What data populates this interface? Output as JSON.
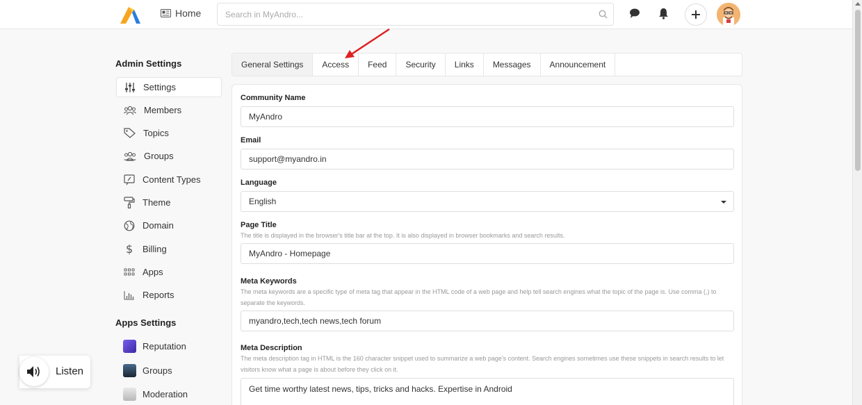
{
  "topbar": {
    "home_label": "Home",
    "search_placeholder": "Search in MyAndro..."
  },
  "sidebar": {
    "admin_heading": "Admin Settings",
    "admin_items": [
      {
        "label": "Settings",
        "icon": "sliders-icon",
        "active": true
      },
      {
        "label": "Members",
        "icon": "members-icon"
      },
      {
        "label": "Topics",
        "icon": "tag-icon"
      },
      {
        "label": "Groups",
        "icon": "groups-icon"
      },
      {
        "label": "Content Types",
        "icon": "content-types-icon"
      },
      {
        "label": "Theme",
        "icon": "paint-roller-icon"
      },
      {
        "label": "Domain",
        "icon": "globe-icon"
      },
      {
        "label": "Billing",
        "icon": "dollar-icon"
      },
      {
        "label": "Apps",
        "icon": "apps-grid-icon"
      },
      {
        "label": "Reports",
        "icon": "bar-chart-icon"
      }
    ],
    "apps_heading": "Apps Settings",
    "apps_items": [
      {
        "label": "Reputation"
      },
      {
        "label": "Groups"
      },
      {
        "label": "Moderation"
      }
    ]
  },
  "listen": {
    "label": "Listen"
  },
  "tabs": [
    {
      "label": "General Settings",
      "active": true
    },
    {
      "label": "Access"
    },
    {
      "label": "Feed"
    },
    {
      "label": "Security"
    },
    {
      "label": "Links"
    },
    {
      "label": "Messages"
    },
    {
      "label": "Announcement"
    }
  ],
  "form": {
    "community_name": {
      "label": "Community Name",
      "value": "MyAndro"
    },
    "email": {
      "label": "Email",
      "value": "support@myandro.in"
    },
    "language": {
      "label": "Language",
      "value": "English"
    },
    "page_title": {
      "label": "Page Title",
      "help": "The title is displayed in the browser's title bar at the top. It is also displayed in browser bookmarks and search results.",
      "value": "MyAndro - Homepage"
    },
    "meta_keywords": {
      "label": "Meta Keywords",
      "help": "The meta keywords are a specific type of meta tag that appear in the HTML code of a web page and help tell search engines what the topic of the page is. Use comma (,) to separate the keywords.",
      "value": "myandro,tech,tech news,tech forum"
    },
    "meta_description": {
      "label": "Meta Description",
      "help": "The meta description tag in HTML is the 160 character snippet used to summarize a web page's content. Search engines sometimes use these snippets in search results to let visitors know what a page is about before they click on it.",
      "value": "Get time worthy latest news, tips, tricks and hacks. Expertise in Android"
    }
  },
  "colors": {
    "annotation_arrow": "#e02020",
    "logo_orange": "#f7a521",
    "logo_blue": "#2a7de1"
  }
}
